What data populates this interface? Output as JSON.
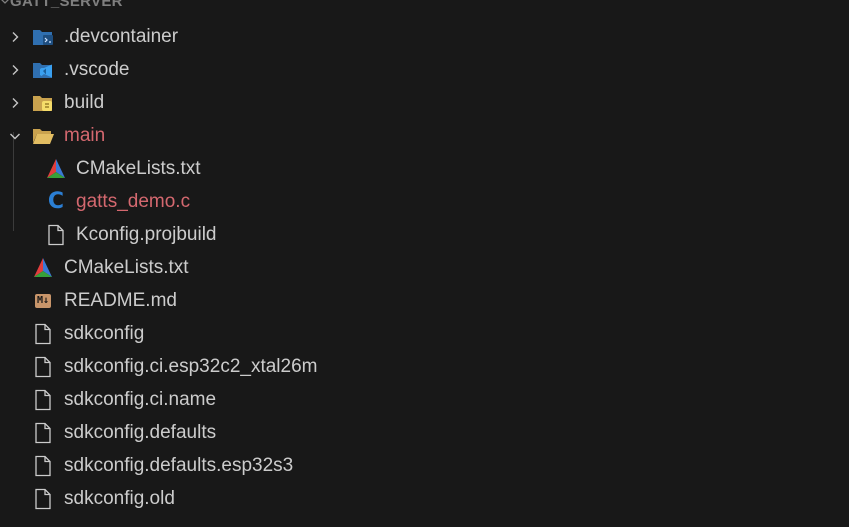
{
  "section": {
    "title": "GATT_SERVER",
    "chevron_icon": "chevron-down-icon"
  },
  "colors": {
    "background": "#181818",
    "text": "#cccccc",
    "modified": "#d4686f",
    "twistie": "#c5c5c5",
    "indent_guide": "#3b3b3b"
  },
  "tree": [
    {
      "label": ".devcontainer",
      "type": "folder",
      "expanded": false,
      "depth": 0,
      "icon": "devcontainer-folder-icon",
      "modified": false
    },
    {
      "label": ".vscode",
      "type": "folder",
      "expanded": false,
      "depth": 0,
      "icon": "vscode-folder-icon",
      "modified": false
    },
    {
      "label": "build",
      "type": "folder",
      "expanded": false,
      "depth": 0,
      "icon": "build-folder-icon",
      "modified": false
    },
    {
      "label": "main",
      "type": "folder",
      "expanded": true,
      "depth": 0,
      "icon": "open-folder-icon",
      "modified": true
    },
    {
      "label": "CMakeLists.txt",
      "type": "file",
      "depth": 1,
      "icon": "cmake-icon",
      "modified": false
    },
    {
      "label": "gatts_demo.c",
      "type": "file",
      "depth": 1,
      "icon": "c-file-icon",
      "modified": true
    },
    {
      "label": "Kconfig.projbuild",
      "type": "file",
      "depth": 1,
      "icon": "file-icon",
      "modified": false
    },
    {
      "label": "CMakeLists.txt",
      "type": "file",
      "depth": 0,
      "icon": "cmake-icon",
      "modified": false
    },
    {
      "label": "README.md",
      "type": "file",
      "depth": 0,
      "icon": "markdown-icon",
      "badge": "M↓",
      "modified": false
    },
    {
      "label": "sdkconfig",
      "type": "file",
      "depth": 0,
      "icon": "file-icon",
      "modified": false
    },
    {
      "label": "sdkconfig.ci.esp32c2_xtal26m",
      "type": "file",
      "depth": 0,
      "icon": "file-icon",
      "modified": false
    },
    {
      "label": "sdkconfig.ci.name",
      "type": "file",
      "depth": 0,
      "icon": "file-icon",
      "modified": false
    },
    {
      "label": "sdkconfig.defaults",
      "type": "file",
      "depth": 0,
      "icon": "file-icon",
      "modified": false
    },
    {
      "label": "sdkconfig.defaults.esp32s3",
      "type": "file",
      "depth": 0,
      "icon": "file-icon",
      "modified": false
    },
    {
      "label": "sdkconfig.old",
      "type": "file",
      "depth": 0,
      "icon": "file-icon",
      "modified": false
    }
  ]
}
